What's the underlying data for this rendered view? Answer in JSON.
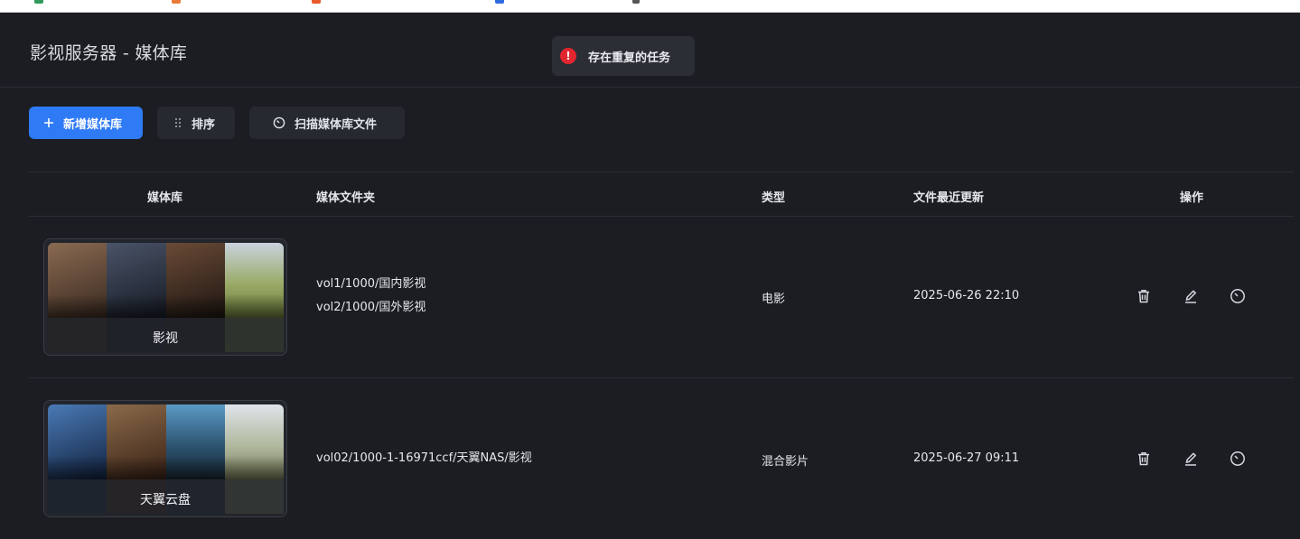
{
  "header": {
    "title": "影视服务器 - 媒体库"
  },
  "toast": {
    "icon": "error-icon",
    "message": "存在重复的任务",
    "color": "#e2262f"
  },
  "toolbar": {
    "add_label": "新增媒体库",
    "sort_label": "排序",
    "scan_label": "扫描媒体库文件",
    "accent": "#2f7af5"
  },
  "table": {
    "headers": [
      "媒体库",
      "媒体文件夹",
      "类型",
      "文件最近更新",
      "操作"
    ],
    "rows": [
      {
        "name": "影视",
        "folders": [
          "vol1/1000/国内影视",
          "vol2/1000/国外影视"
        ],
        "type": "电影",
        "updated": "2025-06-26 22:10",
        "poster_colors": [
          "#6b4a36",
          "#2c3444",
          "#3a2a22",
          "#7a8a4a"
        ]
      },
      {
        "name": "天翼云盘",
        "folders": [
          "vol02/1000-1-16971ccf/天翼NAS/影视"
        ],
        "type": "混合影片",
        "updated": "2025-06-27 09:11",
        "poster_colors": [
          "#2a4e86",
          "#6a4a32",
          "#3c6e8e",
          "#9aa08a"
        ]
      }
    ],
    "actions": [
      "delete-icon",
      "edit-icon",
      "scan-icon"
    ]
  }
}
